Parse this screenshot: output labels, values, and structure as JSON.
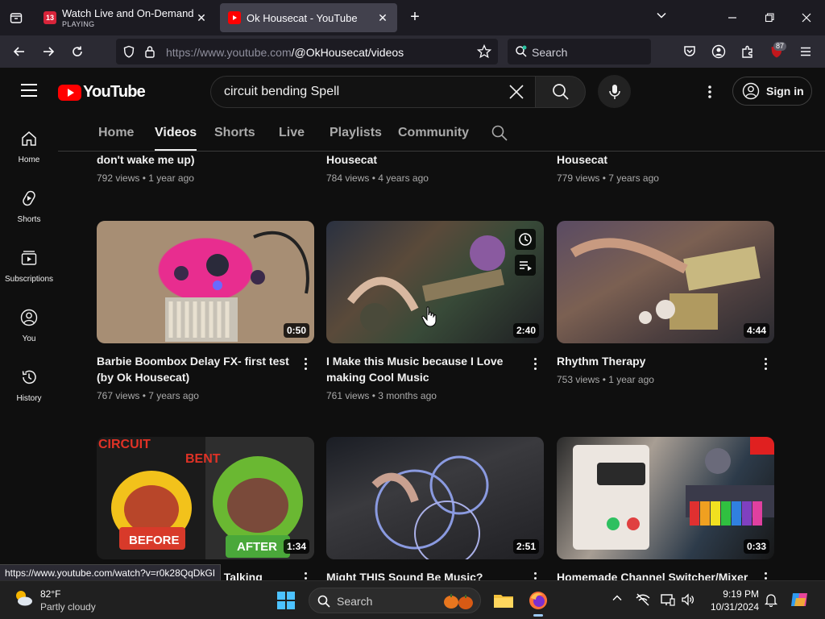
{
  "browser": {
    "tabs": [
      {
        "title": "Watch Live and On-Demand Vi",
        "status": "PLAYING",
        "favicon": "13"
      },
      {
        "title": "Ok Housecat - YouTube"
      }
    ],
    "url_host": "https://www.youtube.com",
    "url_path": "/@OkHousecat/videos",
    "search_placeholder": "Search",
    "extensions_badge": "87",
    "status_url": "https://www.youtube.com/watch?v=r0k28QqDkGI"
  },
  "youtube": {
    "logo": "YouTube",
    "search_value": "circuit bending Spell",
    "sign_in": "Sign in",
    "sidebar": [
      {
        "label": "Home",
        "icon": "home-icon"
      },
      {
        "label": "Shorts",
        "icon": "shorts-icon"
      },
      {
        "label": "Subscriptions",
        "icon": "subscriptions-icon"
      },
      {
        "label": "You",
        "icon": "you-icon"
      },
      {
        "label": "History",
        "icon": "history-icon"
      }
    ],
    "channel_tabs": [
      "Home",
      "Videos",
      "Shorts",
      "Live",
      "Playlists",
      "Community"
    ],
    "active_tab": "Videos",
    "partial_row": [
      {
        "title_tail": "don't wake me up)",
        "meta": "792 views • 1 year ago"
      },
      {
        "title_tail": "Housecat",
        "meta": "784 views • 4 years ago"
      },
      {
        "title_tail": "Housecat",
        "meta": "779 views • 7 years ago"
      }
    ],
    "videos": [
      {
        "title": "Barbie Boombox Delay FX- first test (by Ok Housecat)",
        "duration": "0:50",
        "meta": "767 views • 7 years ago"
      },
      {
        "title": "I Make this Music because I Love making Cool Music",
        "duration": "2:40",
        "meta": "761 views • 3 months ago"
      },
      {
        "title": "Rhythm Therapy",
        "duration": "4:44",
        "meta": "753 views • 1 year ago"
      },
      {
        "title": "i Talking",
        "duration": "1:34",
        "thumb_text": [
          "CIRCUIT",
          "BENT",
          "BEFORE",
          "AFTER"
        ]
      },
      {
        "title": "Might THIS Sound Be Music? please",
        "duration": "2:51"
      },
      {
        "title": "Homemade Channel Switcher/Mixer by",
        "duration": "0:33"
      }
    ]
  },
  "taskbar": {
    "temperature": "82°F",
    "condition": "Partly cloudy",
    "search": "Search",
    "time": "9:19 PM",
    "date": "10/31/2024"
  }
}
